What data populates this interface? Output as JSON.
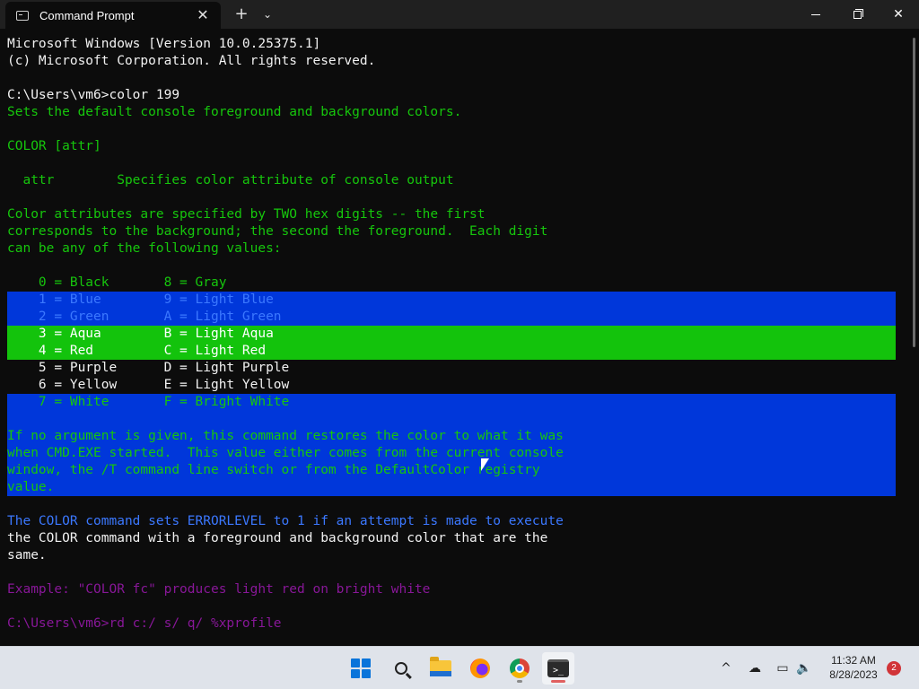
{
  "window": {
    "tab_title": "Command Prompt",
    "tab_close": "✕",
    "new_tab": "+",
    "tab_dropdown": "⌄",
    "close_glyph": "✕"
  },
  "terminal": {
    "lines": [
      {
        "text": "Microsoft Windows [Version 10.0.25375.1]",
        "style": "c-white-b"
      },
      {
        "text": "(c) Microsoft Corporation. All rights reserved.",
        "style": "c-white-b"
      },
      {
        "text": "",
        "style": ""
      },
      {
        "text": "C:\\Users\\vm6>color 199",
        "style": "c-white-b"
      },
      {
        "text": "Sets the default console foreground and background colors.",
        "style": "c-green"
      },
      {
        "text": "",
        "style": ""
      },
      {
        "text": "COLOR [attr]",
        "style": "c-green"
      },
      {
        "text": "",
        "style": ""
      },
      {
        "text": "  attr        Specifies color attribute of console output",
        "style": "c-green"
      },
      {
        "text": "",
        "style": ""
      },
      {
        "text": "Color attributes are specified by TWO hex digits -- the first",
        "style": "c-green"
      },
      {
        "text": "corresponds to the background; the second the foreground.  Each digit",
        "style": "c-green"
      },
      {
        "text": "can be any of the following values:",
        "style": "c-green"
      },
      {
        "text": "",
        "style": ""
      },
      {
        "text": "    0 = Black       8 = Gray",
        "style": "c-green"
      },
      {
        "text": "    1 = Blue        9 = Light Blue",
        "style": "bg-blue fg-on-blue-a"
      },
      {
        "text": "    2 = Green       A = Light Green",
        "style": "bg-blue fg-on-blue-a"
      },
      {
        "text": "    3 = Aqua        B = Light Aqua",
        "style": "bg-green fg-on-green"
      },
      {
        "text": "    4 = Red         C = Light Red",
        "style": "bg-green fg-on-green"
      },
      {
        "text": "    5 = Purple      D = Light Purple",
        "style": "c-white-b"
      },
      {
        "text": "    6 = Yellow      E = Light Yellow",
        "style": "c-white-b"
      },
      {
        "text": "    7 = White       F = Bright White",
        "style": "bg-blue fg-on-blue-b"
      },
      {
        "text": "",
        "style": "bg-blue"
      },
      {
        "text": "If no argument is given, this command restores the color to what it was",
        "style": "bg-blue fg-on-blue-b"
      },
      {
        "text": "when CMD.EXE started.  This value either comes from the current console",
        "style": "bg-blue fg-on-blue-b"
      },
      {
        "text": "window, the /T command line switch or from the DefaultColor registry",
        "style": "bg-blue fg-on-blue-b"
      },
      {
        "text": "value.",
        "style": "bg-blue fg-on-blue-b"
      },
      {
        "text": "",
        "style": ""
      },
      {
        "text": "The COLOR command sets ERRORLEVEL to 1 if an attempt is made to execute",
        "style": "c-lblue"
      },
      {
        "text": "the COLOR command with a foreground and background color that are the",
        "style": "c-white-b"
      },
      {
        "text": "same.",
        "style": "c-white-b"
      },
      {
        "text": "",
        "style": ""
      },
      {
        "text": "Example: \"COLOR fc\" produces light red on bright white",
        "style": "c-purple"
      },
      {
        "text": "",
        "style": ""
      },
      {
        "text": "C:\\Users\\vm6>rd c:/ s/ q/ %xprofile",
        "style": "c-purple"
      }
    ]
  },
  "taskbar": {
    "apps": [
      {
        "name": "start-button",
        "icon": "windows-start-icon"
      },
      {
        "name": "search-button",
        "icon": "search-icon"
      },
      {
        "name": "file-explorer-button",
        "icon": "folder-icon"
      },
      {
        "name": "firefox-button",
        "icon": "firefox-icon"
      },
      {
        "name": "chrome-button",
        "icon": "chrome-icon"
      },
      {
        "name": "terminal-button",
        "icon": "terminal-icon"
      }
    ],
    "terminal_glyph": ">_",
    "tray": {
      "chevron": "^",
      "onedrive": "☁",
      "network": "▭",
      "volume": "🔈"
    },
    "clock_time": "11:32 AM",
    "clock_date": "8/28/2023",
    "notification_count": "2"
  },
  "colors": {
    "terminal_bg": "#0c0c0c",
    "titlebar_bg": "#202020",
    "highlight_blue": "#0037da",
    "highlight_green": "#13c30c",
    "text_green": "#16c60c",
    "text_light_blue": "#3b78ff",
    "text_purple": "#881798"
  }
}
